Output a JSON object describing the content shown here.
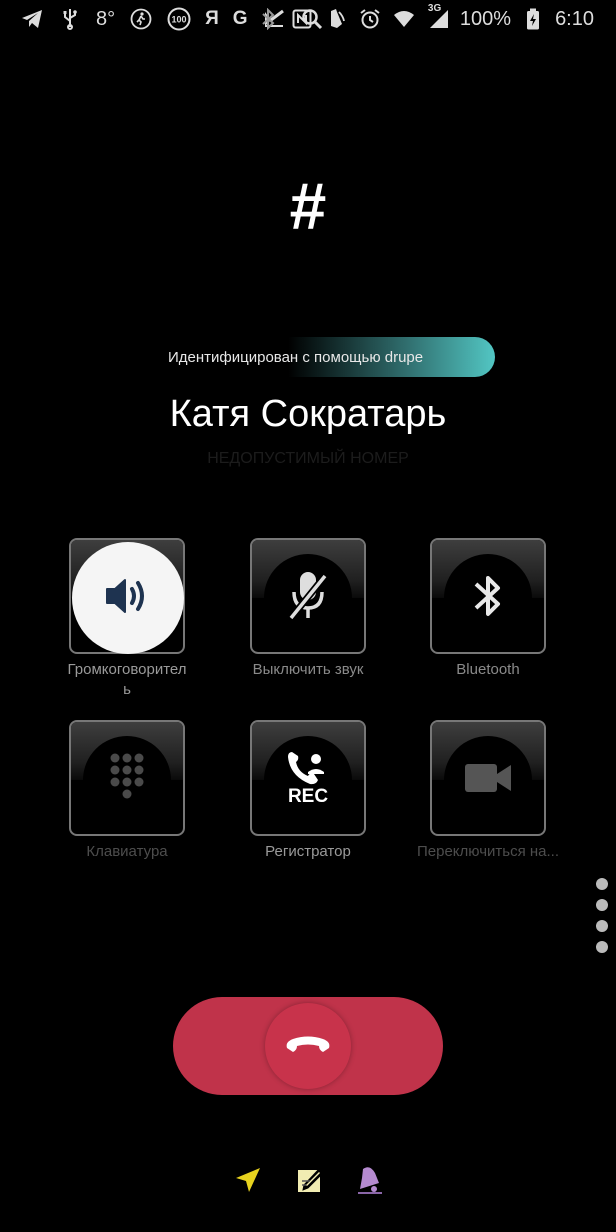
{
  "status_bar": {
    "temperature": "8°",
    "yandex_glyph": "Я",
    "google_glyph": "G",
    "badge_100": "100",
    "network": "3G",
    "battery": "100%",
    "time": "6:10",
    "icons_left": [
      "telegram-icon",
      "usb-icon",
      "temperature",
      "walking-icon",
      "badge-100-icon",
      "yandex-icon",
      "google-icon",
      "tasks-icon",
      "search-icon"
    ],
    "icons_right": [
      "bluetooth-icon",
      "nfc-icon",
      "vibrate-icon",
      "alarm-icon",
      "wifi-icon",
      "signal-icon",
      "battery-icon"
    ]
  },
  "caller": {
    "photo_symbol": "#",
    "identified_by": "Идентифицирован с помощью drupe",
    "name": "Катя Сократарь",
    "status": "НЕДОПУСТИМЫЙ НОМЕР"
  },
  "actions": [
    {
      "label": "Громкоговорител\nь",
      "icon": "speaker-icon",
      "active": true
    },
    {
      "label": "Выключить звук",
      "icon": "mic-off-icon",
      "active": false
    },
    {
      "label": "Bluetooth",
      "icon": "bluetooth-icon",
      "active": false
    },
    {
      "label": "Клавиатура",
      "icon": "keypad-icon",
      "active": false,
      "dim": true
    },
    {
      "label": "Регистратор",
      "icon": "call-recorder-icon",
      "active": false,
      "badge": "REC"
    },
    {
      "label": "Переключиться на...",
      "icon": "video-camera-icon",
      "active": false,
      "dim": true
    }
  ],
  "end_call": {
    "icon": "hang-up-icon",
    "color": "#c0334a"
  },
  "quick_actions": [
    {
      "icon": "send-location-icon",
      "color": "#e7d21e"
    },
    {
      "icon": "note-icon",
      "color": "#f1ecb2"
    },
    {
      "icon": "reminder-bell-icon",
      "color": "#b58ad0"
    }
  ],
  "colors": {
    "background": "#000000",
    "accent_banner": "#52c6c3",
    "speaker_active": "#f5f5f5",
    "speaker_icon": "#1e3350"
  }
}
